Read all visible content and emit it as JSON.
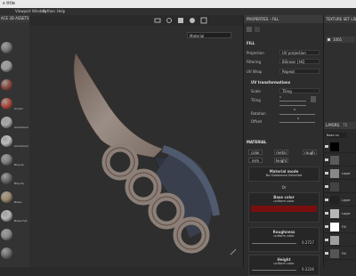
{
  "window": {
    "title": "s title"
  },
  "menu": [
    "",
    "Viewport",
    "Window",
    "Python",
    "Help"
  ],
  "shelf": {
    "title": "ACE 3D ASSETS",
    "items": [
      {
        "label": "",
        "color": "#7a7a7a"
      },
      {
        "label": "",
        "color": "#9b9b9b"
      },
      {
        "label": "",
        "color": "#8c4a40"
      },
      {
        "label": "Acrylic",
        "color": "#b04a3c"
      },
      {
        "label": "Aluminium",
        "color": "#a9a9a9"
      },
      {
        "label": "Aluminium",
        "color": "#bcbcbc"
      },
      {
        "label": "Bicycle",
        "color": "#7f7f7f"
      },
      {
        "label": "Bicycle",
        "color": "#6a6a6a"
      },
      {
        "label": "Brass",
        "color": "#9d8a6a"
      },
      {
        "label": "Brass Foil",
        "color": "#b7b7b7"
      },
      {
        "label": "",
        "color": "#8a8a8a"
      },
      {
        "label": "",
        "color": "#6e6e6e"
      }
    ]
  },
  "viewport": {
    "mode": "Material"
  },
  "properties": {
    "title": "PROPERTIES - FILL",
    "fill": {
      "section": "FILL",
      "projection": {
        "label": "Projection",
        "value": "UV projection"
      },
      "filtering": {
        "label": "Filtering",
        "value": "Bilinear | HQ"
      },
      "uvwrap": {
        "label": "UV Wrap",
        "value": "Repeat"
      }
    },
    "uvt": {
      "section": "UV transformations",
      "scale": {
        "label": "Scale",
        "value": "Tiling"
      },
      "tiling": {
        "label": "Tiling",
        "value": "1"
      },
      "rotation": {
        "label": "Rotation",
        "value": "0"
      },
      "offset": {
        "label": "Offset",
        "value": "0"
      }
    },
    "material": {
      "section": "MATERIAL",
      "buttons": [
        "color",
        "metal",
        "rough",
        "nrm",
        "height"
      ],
      "mode_title": "Material mode",
      "mode_value": "No Substance Selected",
      "or": "Or",
      "base_title": "Base color",
      "base_sub": "uniform color",
      "base_color": "#7a0f10",
      "rough_title": "Roughness",
      "rough_sub": "uniform color",
      "rough_value": "0.2727",
      "height_title": "Height",
      "height_sub": "uniform color",
      "height_value": "0.2226"
    }
  },
  "texset": {
    "title": "TEXTURE SET LIST",
    "item": "1001"
  },
  "layers": {
    "title": "LAYERS",
    "tab2": "TE",
    "blend": "Base co",
    "rows": [
      "",
      "",
      "Layer",
      "",
      "Layer",
      "Layer",
      "Fill",
      "",
      "Fill"
    ]
  }
}
